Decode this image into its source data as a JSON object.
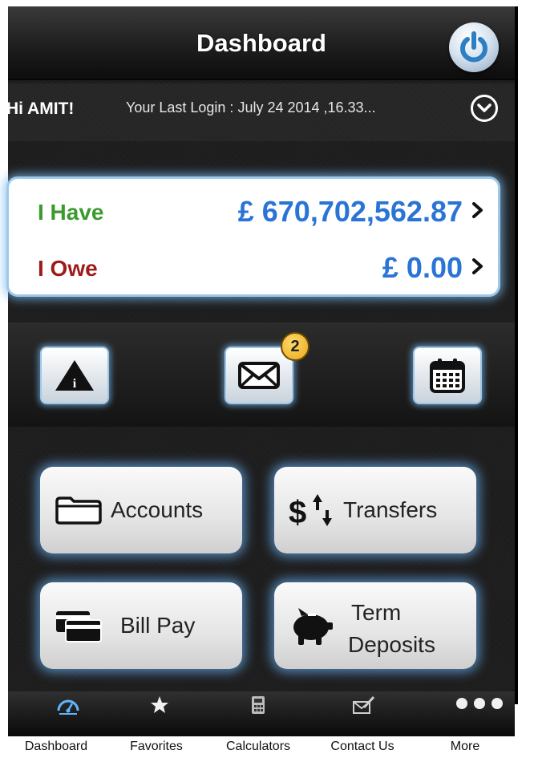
{
  "header": {
    "title": "Dashboard"
  },
  "greeting": {
    "hi": "Hi AMIT!",
    "last_login": "Your Last Login : July 24 2014 ,16.33..."
  },
  "balances": {
    "have_label": "I Have",
    "have_amount": "£ 670,702,562.87",
    "owe_label": "I Owe",
    "owe_amount": "£ 0.00"
  },
  "quick_actions": {
    "messages_badge": "2"
  },
  "menu": {
    "accounts": "Accounts",
    "transfers": "Transfers",
    "bill_pay": "Bill Pay",
    "term_line1": "Term",
    "term_line2": "Deposits"
  },
  "tabs": [
    {
      "label": "Dashboard",
      "icon": "gauge-icon"
    },
    {
      "label": "Favorites",
      "icon": "star-icon"
    },
    {
      "label": "Calculators",
      "icon": "calculator-icon"
    },
    {
      "label": "Contact Us",
      "icon": "envelope-pen-icon"
    },
    {
      "label": "More",
      "icon": "more-dots-icon"
    }
  ],
  "colors": {
    "have": "#3a9a2e",
    "owe": "#9e1b1b",
    "amount": "#2a74d6",
    "glow": "#7ab9f0"
  }
}
